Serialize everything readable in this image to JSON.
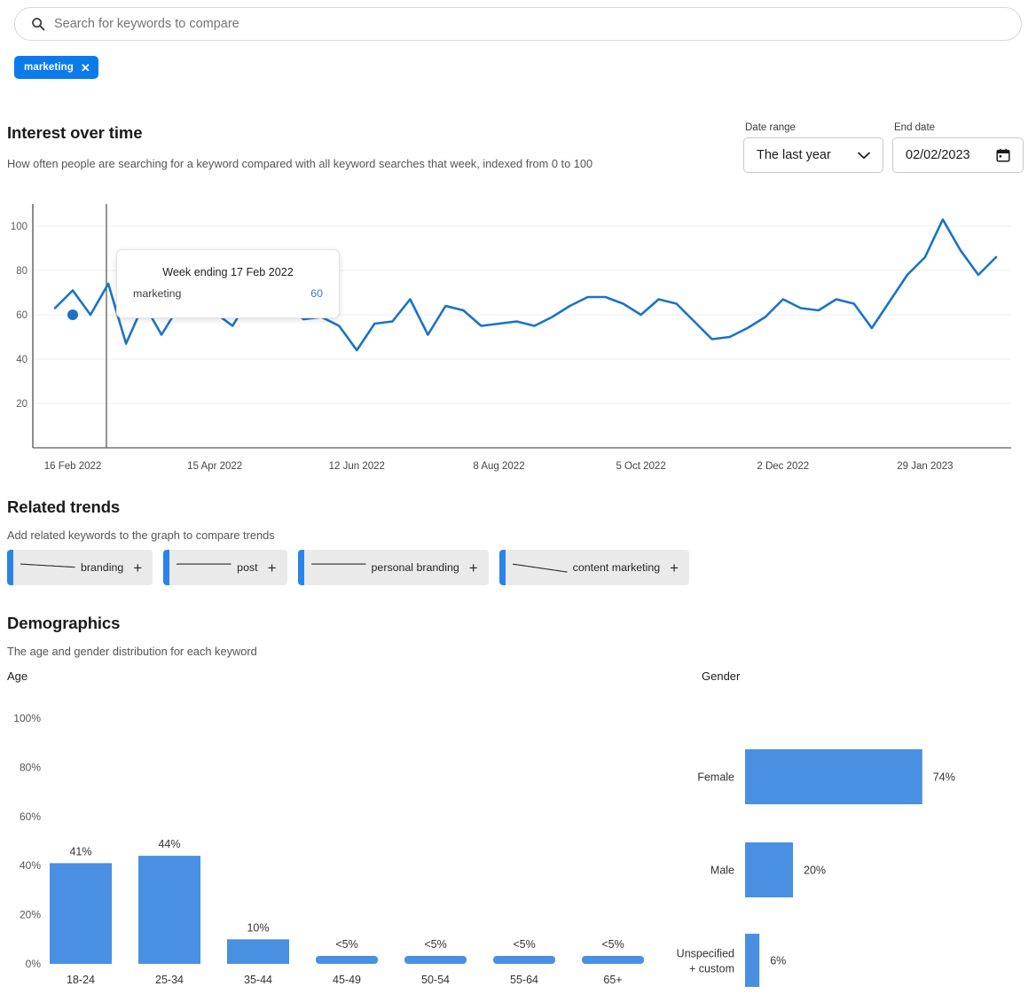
{
  "search": {
    "placeholder": "Search for keywords to compare",
    "value": "",
    "icon": "search-icon"
  },
  "keyword_chips": [
    {
      "label": "marketing",
      "remove_icon": "close-icon"
    }
  ],
  "interest_over_time": {
    "title": "Interest over time",
    "subtitle": "How often people are searching for a keyword compared with all keyword searches that week, indexed from 0 to 100",
    "date_range": {
      "label": "Date range",
      "value": "The last year",
      "icon": "chevron-down-icon"
    },
    "end_date": {
      "label": "End date",
      "value": "02/02/2023",
      "icon": "calendar-icon"
    },
    "tooltip": {
      "title": "Week ending 17 Feb 2022",
      "series_name": "marketing",
      "series_value": "60"
    }
  },
  "related_trends": {
    "title": "Related trends",
    "subtitle": "Add related keywords to the graph to compare trends",
    "items": [
      {
        "label": "branding",
        "add_icon": "plus-icon",
        "sparkline_icon": "sparkline-icon"
      },
      {
        "label": "post",
        "add_icon": "plus-icon",
        "sparkline_icon": "sparkline-icon"
      },
      {
        "label": "personal branding",
        "add_icon": "plus-icon",
        "sparkline_icon": "sparkline-icon"
      },
      {
        "label": "content marketing",
        "add_icon": "plus-icon",
        "sparkline_icon": "sparkline-icon"
      }
    ]
  },
  "demographics": {
    "title": "Demographics",
    "subtitle": "The age and gender distribution for each keyword",
    "age_title": "Age",
    "gender_title": "Gender"
  },
  "colors": {
    "chip_blue": "#0b7beb",
    "line_blue": "#1a73c8",
    "bar_blue": "#4a90e2",
    "related_bar_blue": "#2a84e8",
    "tooltip_value_blue": "#3f78c4"
  },
  "chart_data": [
    {
      "type": "line",
      "name": "interest-over-time",
      "title": "Interest over time",
      "xlabel": "",
      "ylabel": "",
      "ylim": [
        0,
        110
      ],
      "ytick_labels": [
        "100",
        "80",
        "60",
        "40",
        "20"
      ],
      "yticks": [
        100,
        80,
        60,
        40,
        20
      ],
      "grid": true,
      "legend": "none",
      "xtick_labels": [
        "16 Feb 2022",
        "15 Apr 2022",
        "12 Jun 2022",
        "8 Aug 2022",
        "5 Oct 2022",
        "2 Dec 2022",
        "29 Jan 2023"
      ],
      "xtick_indices": [
        1,
        9,
        17,
        25,
        33,
        41,
        49
      ],
      "highlight": {
        "index": 1,
        "label": "Week ending 17 Feb 2022",
        "value": 60
      },
      "series": [
        {
          "name": "marketing",
          "values": [
            63,
            71,
            60,
            74,
            47,
            65,
            51,
            64,
            60,
            61,
            55,
            68,
            60,
            65,
            58,
            59,
            55,
            44,
            56,
            57,
            67,
            51,
            64,
            62,
            55,
            56,
            57,
            55,
            59,
            64,
            68,
            68,
            65,
            60,
            67,
            65,
            57,
            49,
            50,
            54,
            59,
            67,
            63,
            62,
            67,
            65,
            54,
            66,
            78,
            86,
            103,
            89,
            78,
            86
          ]
        }
      ]
    },
    {
      "type": "bar",
      "name": "age-distribution",
      "title": "Age",
      "orientation": "vertical",
      "categories": [
        "18-24",
        "25-34",
        "35-44",
        "45-49",
        "50-54",
        "55-64",
        "65+"
      ],
      "values": [
        41,
        44,
        10,
        2,
        2,
        2,
        2
      ],
      "value_labels": [
        "41%",
        "44%",
        "10%",
        "<5%",
        "<5%",
        "<5%",
        "<5%"
      ],
      "ylim": [
        0,
        100
      ],
      "ytick_labels": [
        "100%",
        "80%",
        "60%",
        "40%",
        "20%",
        "0%"
      ],
      "yticks": [
        100,
        80,
        60,
        40,
        20,
        0
      ],
      "grid": false,
      "legend": "none"
    },
    {
      "type": "bar",
      "name": "gender-distribution",
      "title": "Gender",
      "orientation": "horizontal",
      "categories": [
        "Female",
        "Male",
        "Unspecified\n+ custom"
      ],
      "category_labels": [
        [
          "Female"
        ],
        [
          "Male"
        ],
        [
          "Unspecified",
          "+ custom"
        ]
      ],
      "values": [
        74,
        20,
        6
      ],
      "value_labels": [
        "74%",
        "20%",
        "6%"
      ],
      "xlim": [
        0,
        100
      ],
      "grid": false,
      "legend": "none"
    }
  ]
}
